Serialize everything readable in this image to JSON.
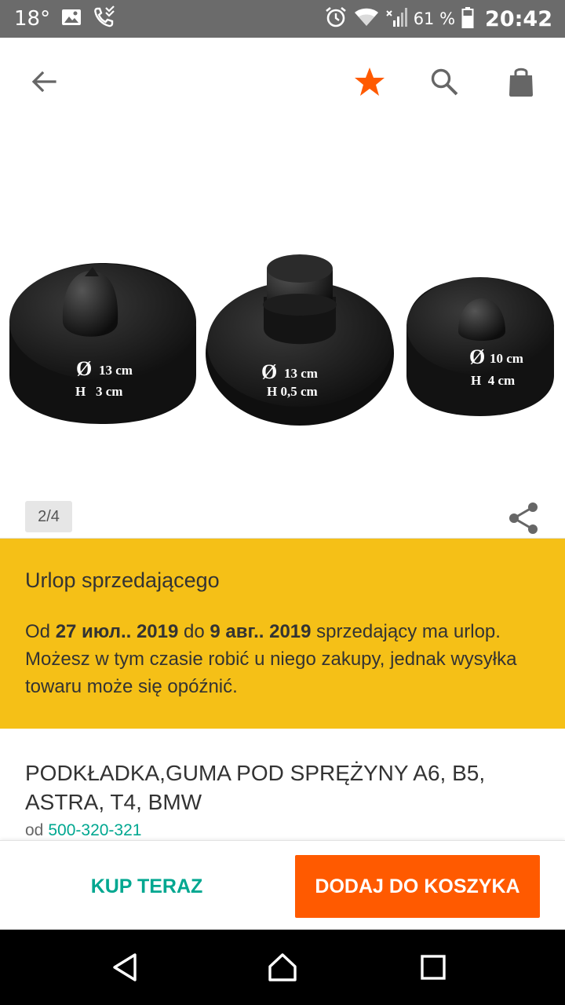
{
  "status_bar": {
    "temperature": "18°",
    "battery_percent": "61 %",
    "time": "20:42"
  },
  "action_bar": {
    "back_icon": "arrow-back-icon",
    "favorite_icon": "star-icon",
    "search_icon": "search-icon",
    "cart_icon": "shopping-bag-icon",
    "favorite_color": "#ff5a00"
  },
  "gallery": {
    "page_counter": "2/4",
    "share_icon": "share-icon",
    "labels": [
      {
        "diameter": "13 cm",
        "height": "H   3 cm"
      },
      {
        "diameter": "13 cm",
        "height": "H 0,5 cm"
      },
      {
        "diameter": "10 cm",
        "height": "H  4 cm"
      }
    ]
  },
  "vacation": {
    "title": "Urlop sprzedającego",
    "text_prefix": "Od ",
    "date_from": "27 июл.. 2019",
    "text_mid": " do ",
    "date_to": "9 авг.. 2019",
    "text_suffix": " sprzedający ma urlop. Możesz w tym czasie robić u niego zakupy, jednak wysyłka towaru może się opóźnić.",
    "background_color": "#f5c017"
  },
  "product": {
    "title": "PODKŁADKA,GUMA POD SPRĘŻYNY A6, B5, ASTRA, T4, BMW",
    "seller_prefix": "od",
    "seller_name": "500-320-321",
    "link_color": "#00a790"
  },
  "actions": {
    "buy_now": "KUP TERAZ",
    "add_to_cart": "DODAJ DO KOSZYKA",
    "accent_color": "#ff5a00"
  },
  "nav_bar": {
    "back_icon": "nav-back-icon",
    "home_icon": "nav-home-icon",
    "recent_icon": "nav-recent-icon"
  }
}
